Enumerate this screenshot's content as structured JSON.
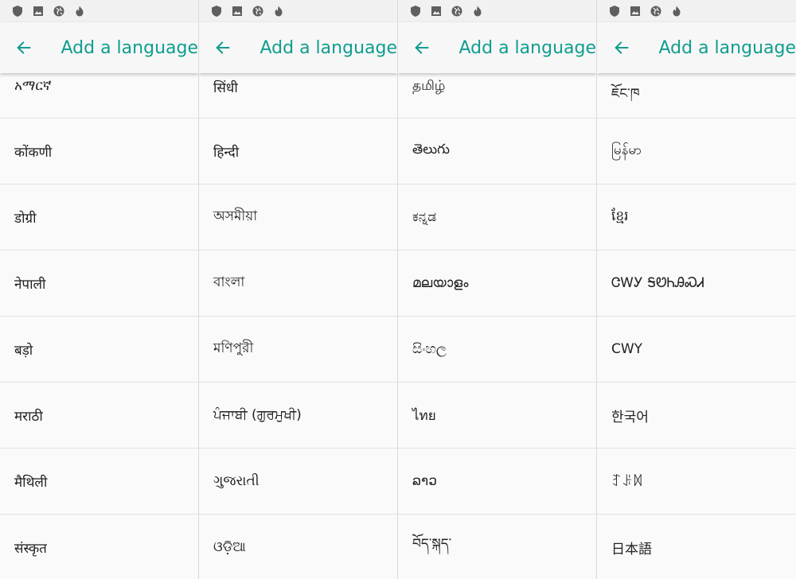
{
  "accent_color": "#0f9d8f",
  "panels": [
    {
      "title": "Add a language",
      "status_icons": [
        "shield-icon",
        "image-icon",
        "globe-icon",
        "flame-icon"
      ],
      "items": [
        "አማርኛ",
        "कोंकणी",
        "डोग्री",
        "नेपाली",
        "बड़ो",
        "मराठी",
        "मैथिली",
        "संस्कृत"
      ]
    },
    {
      "title": "Add a language",
      "status_icons": [
        "shield-icon",
        "image-icon",
        "globe-icon",
        "flame-icon"
      ],
      "items": [
        "सिंधी",
        "हिन्दी",
        "অসমীয়া",
        "বাংলা",
        "মণিপুরী",
        "ਪੰਜਾਬੀ (ਗੁਰਮੁਖੀ)",
        "ગુજરાતી",
        "ଓଡ଼ିଆ"
      ]
    },
    {
      "title": "Add a language",
      "status_icons": [
        "shield-icon",
        "image-icon",
        "globe-icon",
        "flame-icon"
      ],
      "items": [
        "தமிழ்",
        "తెలుగు",
        "ಕನ್ನಡ",
        "മലയാളം",
        "සිංහල",
        "ไทย",
        "ລາວ",
        "བོད་སྐད་"
      ]
    },
    {
      "title": "Add a language",
      "status_icons": [
        "shield-icon",
        "image-icon",
        "globe-icon",
        "flame-icon"
      ],
      "items": [
        "ཇོང་ཁ",
        "မြန်မာ",
        "ខ្មែរ",
        "ᏣᎳᎩ ᎦᏬᏂᎯᏍᏗ",
        "CWY",
        "한국어",
        "ꆈꌠꉙ",
        "日本語"
      ]
    }
  ]
}
